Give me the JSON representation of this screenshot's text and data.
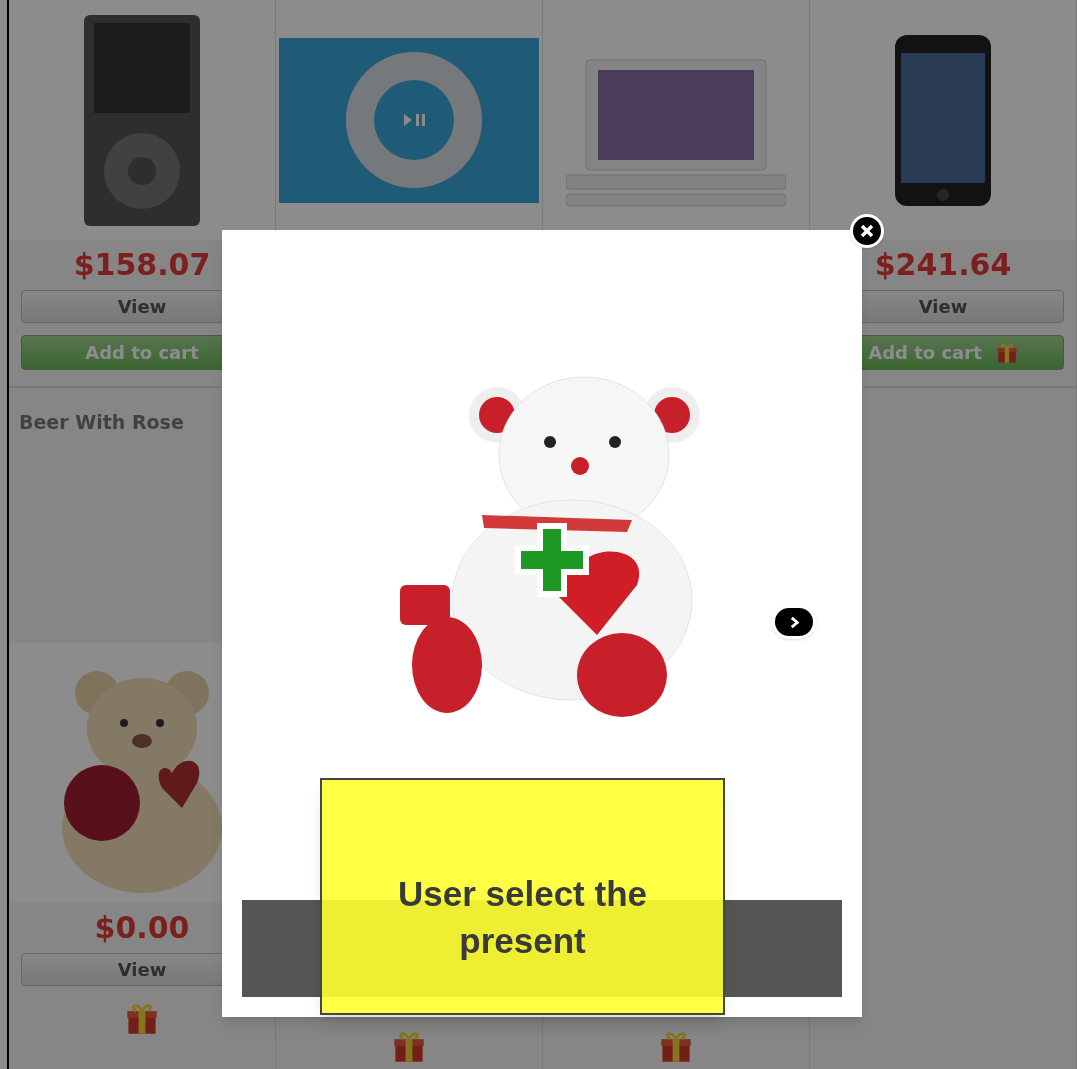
{
  "products": [
    {
      "kind": "music-player-gray",
      "price": "$158.07",
      "view_button": "View",
      "cart_button": "Add to cart",
      "cart_gift": false
    },
    {
      "kind": "music-player-blue"
    },
    {
      "kind": "laptop"
    },
    {
      "kind": "phone",
      "price": "$241.64",
      "view_button": "View",
      "cart_button": "Add to cart",
      "cart_gift": true
    },
    {
      "title": "Beer With Rose",
      "kind": "bear-with-roses",
      "price": "$0.00",
      "view_button": "View",
      "gift": true
    },
    {
      "gift": true
    },
    {
      "gift": true
    }
  ],
  "lightbox": {
    "kind": "bear-with-heart",
    "callout": "User select the present"
  }
}
